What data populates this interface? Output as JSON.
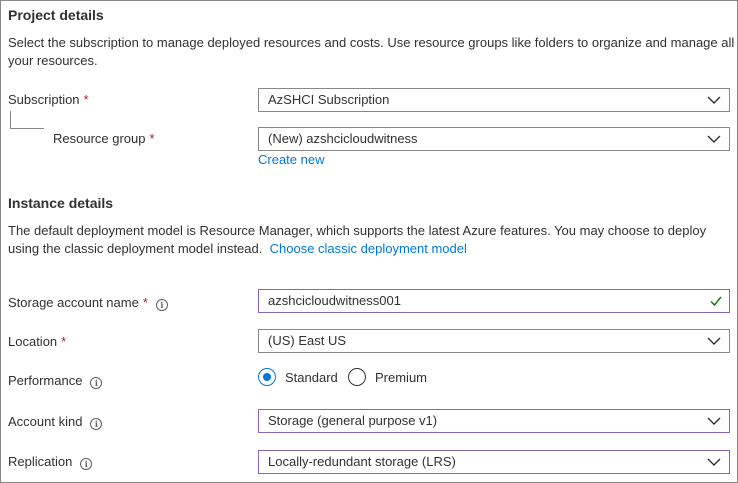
{
  "project": {
    "heading": "Project details",
    "description_line1": "Select the subscription to manage deployed resources and costs. Use resource groups like folders to organize and manage all",
    "description_line2": "your resources.",
    "subscription_label": "Subscription",
    "subscription_value": "AzSHCI Subscription",
    "resource_group_label": "Resource group",
    "resource_group_value": "(New) azshcicloudwitness",
    "create_new_link": "Create new"
  },
  "instance": {
    "heading": "Instance details",
    "description_line1": "The default deployment model is Resource Manager, which supports the latest Azure features. You may choose to deploy",
    "description_line2": "using the classic deployment model instead.",
    "classic_link": "Choose classic deployment model",
    "storage_name_label": "Storage account name",
    "storage_name_value": "azshcicloudwitness001",
    "location_label": "Location",
    "location_value": "(US) East US",
    "performance_label": "Performance",
    "performance_options": [
      "Standard",
      "Premium"
    ],
    "performance_selected": "Standard",
    "account_kind_label": "Account kind",
    "account_kind_value": "Storage (general purpose v1)",
    "replication_label": "Replication",
    "replication_value": "Locally-redundant storage (LRS)"
  },
  "required_mark": "*",
  "info_glyph": "i",
  "colors": {
    "link": "#0078d4",
    "required": "#a4262c",
    "focus_border": "#8764b8",
    "valid_check": "#107c10"
  }
}
